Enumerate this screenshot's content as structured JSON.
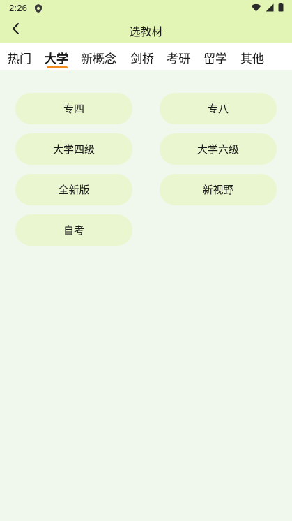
{
  "status": {
    "time": "2:26",
    "icons": [
      "shield-icon",
      "wifi-icon",
      "signal-icon",
      "battery-icon"
    ]
  },
  "header": {
    "title": "选教材",
    "back_icon": "chevron-left-icon"
  },
  "tabs": [
    {
      "label": "热门",
      "active": false
    },
    {
      "label": "大学",
      "active": true
    },
    {
      "label": "新概念",
      "active": false
    },
    {
      "label": "剑桥",
      "active": false
    },
    {
      "label": "考研",
      "active": false
    },
    {
      "label": "留学",
      "active": false
    },
    {
      "label": "其他",
      "active": false
    }
  ],
  "books": [
    {
      "label": "专四"
    },
    {
      "label": "专八"
    },
    {
      "label": "大学四级"
    },
    {
      "label": "大学六级"
    },
    {
      "label": "全新版"
    },
    {
      "label": "新视野"
    },
    {
      "label": "自考"
    }
  ],
  "colors": {
    "header_bg": "#E3F5B5",
    "page_bg": "#F0F7EC",
    "pill_bg": "#EAF6CF",
    "accent": "#F08A1A"
  }
}
